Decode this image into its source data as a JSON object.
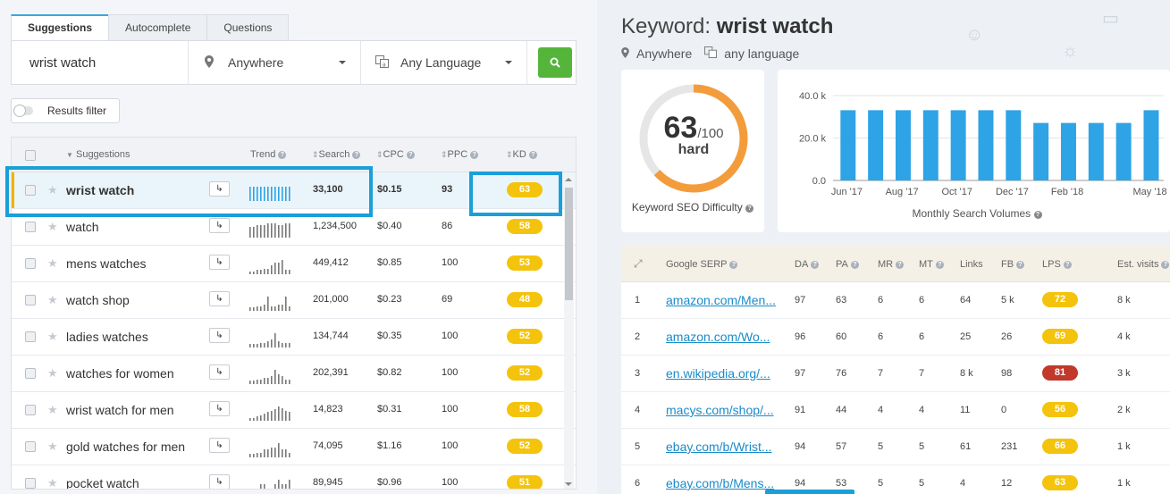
{
  "tabs": [
    "Suggestions",
    "Autocomplete",
    "Questions"
  ],
  "search": {
    "keyword": "wrist watch",
    "location": "Anywhere",
    "language": "Any Language",
    "button_icon": "search-icon"
  },
  "filter_label": "Results filter",
  "table": {
    "headers": {
      "suggestions": "Suggestions",
      "trend": "Trend",
      "search": "Search",
      "cpc": "CPC",
      "ppc": "PPC",
      "kd": "KD"
    },
    "rows": [
      {
        "keyword": "wrist watch",
        "search": "33,100",
        "cpc": "$0.15",
        "ppc": "93",
        "kd": "63",
        "trend": [
          9,
          9,
          9,
          9,
          9,
          9,
          9,
          9,
          9,
          9,
          9,
          9
        ]
      },
      {
        "keyword": "watch",
        "search": "1,234,500",
        "cpc": "$0.40",
        "ppc": "86",
        "kd": "58",
        "trend": [
          7,
          7,
          8,
          8,
          8,
          9,
          9,
          9,
          8,
          8,
          9,
          9
        ]
      },
      {
        "keyword": "mens watches",
        "search": "449,412",
        "cpc": "$0.85",
        "ppc": "100",
        "kd": "53",
        "trend": [
          2,
          2,
          3,
          3,
          4,
          4,
          6,
          8,
          8,
          10,
          3,
          3
        ]
      },
      {
        "keyword": "watch shop",
        "search": "201,000",
        "cpc": "$0.23",
        "ppc": "69",
        "kd": "48",
        "trend": [
          2,
          2,
          3,
          3,
          4,
          9,
          3,
          3,
          4,
          4,
          9,
          3
        ]
      },
      {
        "keyword": "ladies watches",
        "search": "134,744",
        "cpc": "$0.35",
        "ppc": "100",
        "kd": "52",
        "trend": [
          2,
          2,
          2,
          3,
          3,
          4,
          5,
          9,
          4,
          3,
          3,
          3
        ]
      },
      {
        "keyword": "watches for women",
        "search": "202,391",
        "cpc": "$0.82",
        "ppc": "100",
        "kd": "52",
        "trend": [
          2,
          2,
          3,
          3,
          4,
          4,
          5,
          9,
          6,
          5,
          3,
          3
        ]
      },
      {
        "keyword": "wrist watch for men",
        "search": "14,823",
        "cpc": "$0.31",
        "ppc": "100",
        "kd": "58",
        "trend": [
          2,
          2,
          3,
          4,
          5,
          6,
          7,
          8,
          10,
          9,
          7,
          6
        ]
      },
      {
        "keyword": "gold watches for men",
        "search": "74,095",
        "cpc": "$1.16",
        "ppc": "100",
        "kd": "52",
        "trend": [
          2,
          2,
          3,
          3,
          5,
          5,
          6,
          6,
          9,
          5,
          5,
          3
        ]
      },
      {
        "keyword": "pocket watch",
        "search": "89,945",
        "cpc": "$0.96",
        "ppc": "100",
        "kd": "51",
        "trend": [
          1,
          1,
          1,
          2,
          2,
          1,
          1,
          2,
          3,
          2,
          2,
          3
        ]
      }
    ]
  },
  "detail": {
    "title_prefix": "Keyword:",
    "title_keyword": "wrist watch",
    "location": "Anywhere",
    "language": "any language",
    "difficulty_value": "63",
    "difficulty_max": "/100",
    "difficulty_score": 0.63,
    "difficulty_label": "hard",
    "difficulty_caption": "Keyword SEO Difficulty",
    "volume_caption": "Monthly Search Volumes"
  },
  "chart_data": {
    "type": "bar",
    "y_ticks": [
      "40.0 k",
      "20.0 k",
      "0.0"
    ],
    "ylim": [
      0,
      40000
    ],
    "x_tick_labels": [
      "Jun '17",
      "Aug '17",
      "Oct '17",
      "Dec '17",
      "Feb '18",
      "May '18"
    ],
    "values": [
      33100,
      33100,
      33100,
      33100,
      33100,
      33100,
      33100,
      27100,
      27100,
      27100,
      27100,
      33100
    ],
    "color": "#2ea3e6"
  },
  "serp": {
    "headers": [
      "Google SERP",
      "DA",
      "PA",
      "MR",
      "MT",
      "Links",
      "FB",
      "LPS",
      "Est. visits"
    ],
    "rows": [
      {
        "rank": "1",
        "url": "amazon.com/Men...",
        "da": "97",
        "pa": "63",
        "mr": "6",
        "mt": "6",
        "links": "64",
        "fb": "5 k",
        "lps": "72",
        "lps_color": "#f4c30c",
        "visits": "8 k"
      },
      {
        "rank": "2",
        "url": "amazon.com/Wo...",
        "da": "96",
        "pa": "60",
        "mr": "6",
        "mt": "6",
        "links": "25",
        "fb": "26",
        "lps": "69",
        "lps_color": "#f4c30c",
        "visits": "4 k"
      },
      {
        "rank": "3",
        "url": "en.wikipedia.org/...",
        "da": "97",
        "pa": "76",
        "mr": "7",
        "mt": "7",
        "links": "8 k",
        "fb": "98",
        "lps": "81",
        "lps_color": "#c0392b",
        "visits": "3 k"
      },
      {
        "rank": "4",
        "url": "macys.com/shop/...",
        "da": "91",
        "pa": "44",
        "mr": "4",
        "mt": "4",
        "links": "11",
        "fb": "0",
        "lps": "56",
        "lps_color": "#f4c30c",
        "visits": "2 k"
      },
      {
        "rank": "5",
        "url": "ebay.com/b/Wrist...",
        "da": "94",
        "pa": "57",
        "mr": "5",
        "mt": "5",
        "links": "61",
        "fb": "231",
        "lps": "66",
        "lps_color": "#f4c30c",
        "visits": "1 k"
      },
      {
        "rank": "6",
        "url": "ebay.com/b/Mens...",
        "da": "94",
        "pa": "53",
        "mr": "5",
        "mt": "5",
        "links": "4",
        "fb": "12",
        "lps": "63",
        "lps_color": "#f4c30c",
        "visits": "1 k"
      }
    ]
  }
}
